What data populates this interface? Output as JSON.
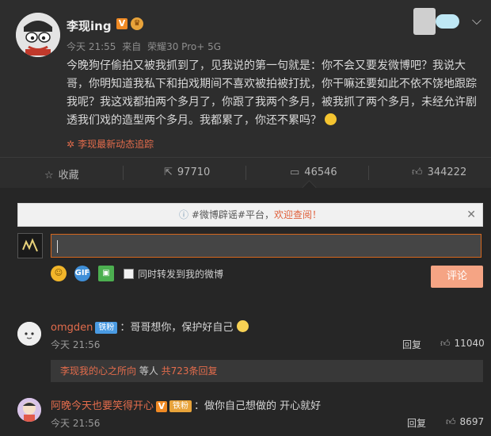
{
  "post": {
    "username": "李现ing",
    "v_badge": "V",
    "meta_time": "今天 21:55",
    "meta_from": "来自",
    "meta_device": "荣耀30 Pro+ 5G",
    "content": "今晚狗仔偷拍又被我抓到了，见我说的第一句就是：你不会又要发微博吧？我说大哥，你明知道我私下和拍戏期间不喜欢被拍被打扰，你干嘛还要如此不依不饶地跟踪我呢？我这戏都拍两个多月了，你跟了我两个多月，被我抓了两个多月，未经允许剧透我们戏的造型两个多月。我都累了，你还不累吗？",
    "trace_label": "李现最新动态追踪"
  },
  "actions": {
    "favorite": "收藏",
    "repost": "97710",
    "comment": "46546",
    "like": "344222"
  },
  "composer": {
    "notice_part1": "#微博辟谣#平台，",
    "notice_part2": "欢迎查阅！",
    "input_value": "",
    "repost_checkbox_label": "同时转发到我的微博",
    "submit_label": "评论"
  },
  "comments": [
    {
      "name": "omgden",
      "badge": "铁粉",
      "text": "：哥哥想你，保护好自己",
      "time": "今天 21:56",
      "reply": "回复",
      "likes": "11040",
      "subreply": {
        "who": "李现我的心之所向",
        "mid": " 等人 ",
        "count": "共723条回复"
      }
    },
    {
      "name": "阿晚今天也要笑得开心",
      "v_badge": "V",
      "badge": "铁粉",
      "text": "：做你自己想做的 开心就好",
      "time": "今天 21:56",
      "reply": "回复",
      "likes": "8697"
    }
  ],
  "colors": {
    "accent": "#e36c4c",
    "background": "#262626",
    "submit": "#f5a484"
  }
}
